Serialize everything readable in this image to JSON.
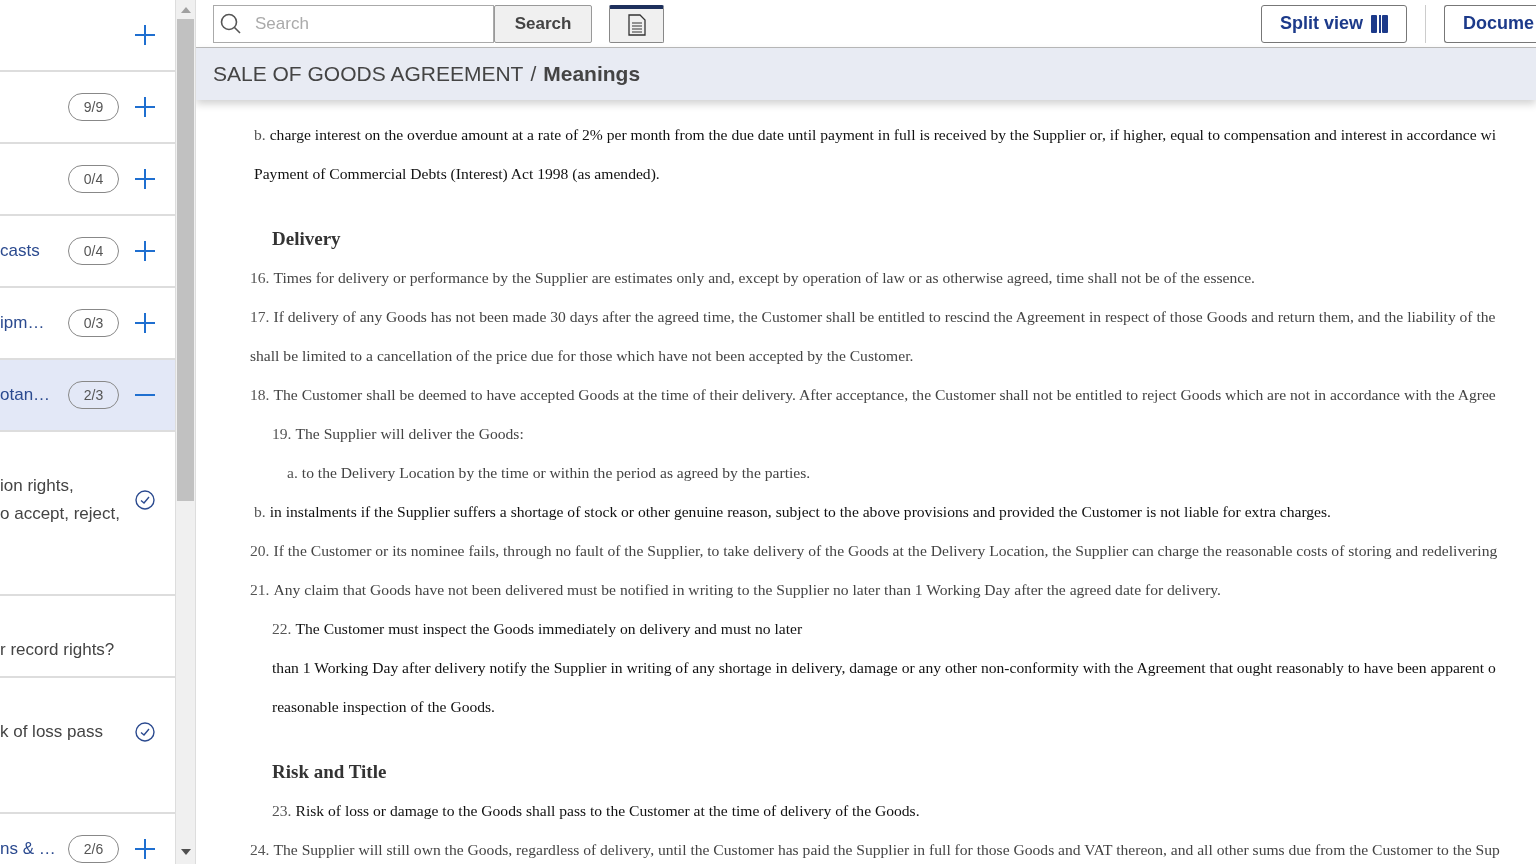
{
  "sidebar": {
    "items": [
      {
        "kind": "section",
        "selected": false,
        "expanded": false
      },
      {
        "kind": "section",
        "count": "9/9",
        "selected": false,
        "expanded": false
      },
      {
        "kind": "section",
        "count": "0/4",
        "selected": false,
        "expanded": false
      },
      {
        "kind": "section",
        "label": "casts",
        "count": "0/4",
        "selected": false,
        "expanded": false
      },
      {
        "kind": "section",
        "label": "ipm…",
        "count": "0/3",
        "selected": false,
        "expanded": false
      },
      {
        "kind": "section",
        "label": "otan…",
        "count": "2/3",
        "selected": true,
        "expanded": true
      },
      {
        "kind": "question",
        "lines": [
          "ion rights,",
          "o accept, reject,"
        ],
        "answered": true
      },
      {
        "kind": "question",
        "lines": [
          "r record rights?"
        ],
        "answered": false
      },
      {
        "kind": "question",
        "lines": [
          "k of loss pass"
        ],
        "answered": true
      },
      {
        "kind": "section",
        "label": "ns & …",
        "count": "2/6",
        "selected": false,
        "expanded": false
      }
    ]
  },
  "toolbar": {
    "search": {
      "placeholder": "Search"
    },
    "search_button": "Search",
    "doc_view": {
      "selected": true
    },
    "buttons": [
      {
        "kind": "split",
        "label": "Split view"
      },
      {
        "kind": "plain",
        "label": "Docume"
      }
    ]
  },
  "breadcrumb": {
    "document": "SALE OF GOODS AGREEMENT",
    "separator": "/",
    "current": "Meanings"
  },
  "document": {
    "lines": [
      {
        "kind": "point",
        "num": "b.",
        "text": "charge interest on the overdue amount at a rate of 2% per month from the due date until payment in full is received by the Supplier or, if higher, equal to compensation and interest in accordance wi",
        "muted": false
      },
      {
        "kind": "point",
        "text": "Payment of Commercial Debts (Interest) Act 1998 (as amended).",
        "muted": false
      },
      {
        "kind": "heading",
        "text": "Delivery"
      },
      {
        "kind": "clause",
        "num": "16.",
        "text": "Times for delivery or performance by the Supplier are estimates only and, except by operation of law or as otherwise agreed, time shall not be of the essence.",
        "muted": true
      },
      {
        "kind": "clause",
        "num": "17.",
        "text": "If delivery of any Goods has not been made 30 days after the agreed time, the Customer shall be entitled to rescind the Agreement in respect of those Goods and return them, and the liability of the",
        "muted": true
      },
      {
        "kind": "clause",
        "text": "shall be limited to a cancellation of the price due for those which have not been accepted by the Customer.",
        "muted": true
      },
      {
        "kind": "clause",
        "num": "18.",
        "text": "The Customer shall be deemed to have accepted Goods at the time of their delivery. After acceptance, the Customer shall not be entitled to reject Goods which are not in accordance with the Agree",
        "muted": true
      },
      {
        "kind": "subclause",
        "num": "19.",
        "text": "The Supplier will deliver the Goods:",
        "muted": true
      },
      {
        "kind": "subpoint",
        "num": "a.",
        "text": "to the Delivery Location by the time or within the period as agreed by the parties.",
        "muted": true
      },
      {
        "kind": "point",
        "num": "b.",
        "text": "in instalments if the Supplier suffers a shortage of stock or other genuine reason, subject to the above provisions and provided the Customer is not liable for extra charges.",
        "muted": false
      },
      {
        "kind": "clause",
        "num": "20.",
        "text": "If the Customer or its nominee fails, through no fault of the Supplier, to take delivery of the Goods at the Delivery Location, the Supplier can charge the reasonable costs of storing and redelivering",
        "muted": true
      },
      {
        "kind": "clause",
        "num": "21.",
        "text": "Any claim that Goods have not been delivered must be notified in writing to the Supplier no later than 1 Working Day after the agreed date for delivery.",
        "muted": true
      },
      {
        "kind": "subclause",
        "num": "22.",
        "text": "The Customer must inspect the Goods immediately on delivery and must no later",
        "muted": false
      },
      {
        "kind": "subclause",
        "text": "than 1 Working Day after delivery notify the Supplier in writing of any shortage in delivery, damage or any other non-conformity with the Agreement that ought reasonably to have been apparent o",
        "muted": false
      },
      {
        "kind": "subclause",
        "text": "reasonable inspection of the Goods.",
        "muted": false
      },
      {
        "kind": "heading",
        "text": "Risk and Title"
      },
      {
        "kind": "subclause",
        "num": "23.",
        "text": "Risk of loss or damage to the Goods shall pass to the Customer at the time of delivery of the Goods.",
        "muted": false
      },
      {
        "kind": "clause",
        "num": "24.",
        "text": "The Supplier will still own the Goods, regardless of delivery, until the Customer has paid the Supplier in full for those Goods and VAT thereon, and all other sums due from the Customer to the Sup",
        "muted": true
      }
    ]
  }
}
